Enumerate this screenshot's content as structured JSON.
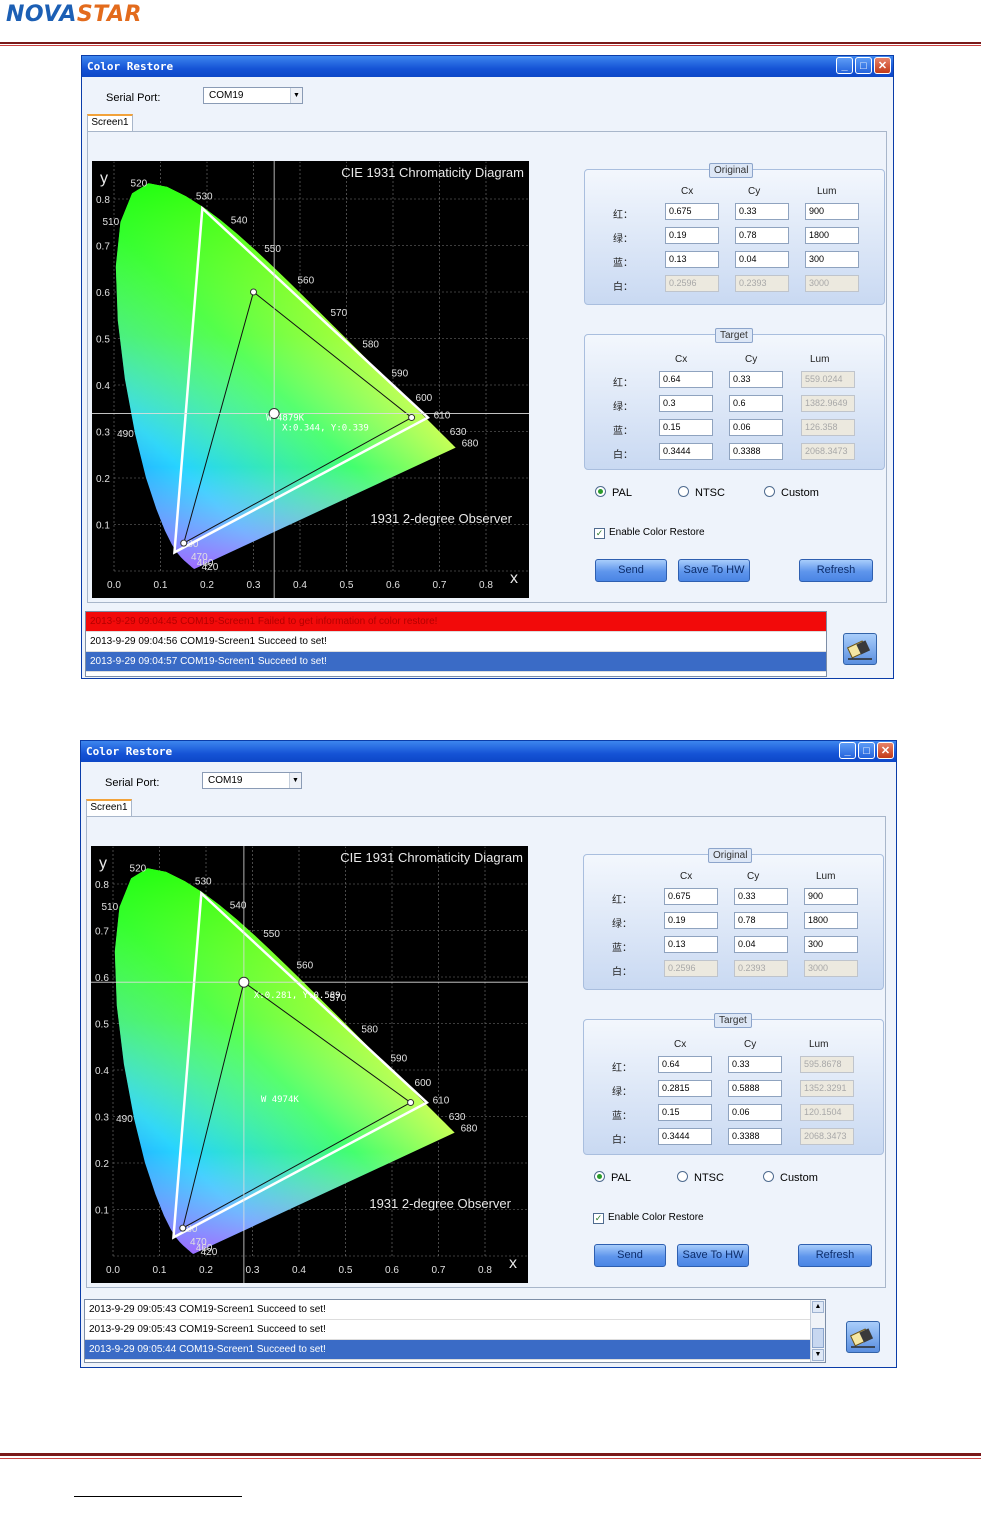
{
  "header": {
    "logo_a": "NOVA",
    "logo_b": "STAR"
  },
  "windows": [
    {
      "title": "Color Restore",
      "serial_port_label": "Serial Port:",
      "serial_port_value": "COM19",
      "tab": "Screen1",
      "chart": {
        "title": "CIE 1931 Chromaticity Diagram",
        "observer": "1931 2-degree Observer",
        "xlabel": "x",
        "ylabel": "y",
        "cursor_label": "W 4879K",
        "cursor_coords": "X:0.344, Y:0.339"
      },
      "original": {
        "title": "Original",
        "headers": [
          "Cx",
          "Cy",
          "Lum"
        ],
        "rows": [
          {
            "label": "红：",
            "cx": "0.675",
            "cy": "0.33",
            "lum": "900"
          },
          {
            "label": "绿：",
            "cx": "0.19",
            "cy": "0.78",
            "lum": "1800"
          },
          {
            "label": "蓝：",
            "cx": "0.13",
            "cy": "0.04",
            "lum": "300"
          },
          {
            "label": "白：",
            "cx": "0.2596",
            "cy": "0.2393",
            "lum": "3000"
          }
        ]
      },
      "target": {
        "title": "Target",
        "headers": [
          "Cx",
          "Cy",
          "Lum"
        ],
        "rows": [
          {
            "label": "红：",
            "cx": "0.64",
            "cy": "0.33",
            "lum": "559.0244"
          },
          {
            "label": "绿：",
            "cx": "0.3",
            "cy": "0.6",
            "lum": "1382.9649"
          },
          {
            "label": "蓝：",
            "cx": "0.15",
            "cy": "0.06",
            "lum": "126.358"
          },
          {
            "label": "白：",
            "cx": "0.3444",
            "cy": "0.3388",
            "lum": "2068.3473"
          }
        ]
      },
      "radios": [
        "PAL",
        "NTSC",
        "Custom"
      ],
      "selected_radio": "PAL",
      "enable_label": "Enable Color Restore",
      "enable_checked": true,
      "buttons": {
        "send": "Send",
        "save": "Save To HW",
        "refresh": "Refresh"
      },
      "log": [
        "2013-9-29 09:04:45 COM19-Screen1 Failed to get information of color restore!",
        "2013-9-29 09:04:56 COM19-Screen1 Succeed to set!",
        "2013-9-29 09:04:57 COM19-Screen1 Succeed to set!"
      ]
    },
    {
      "title": "Color Restore",
      "serial_port_label": "Serial Port:",
      "serial_port_value": "COM19",
      "tab": "Screen1",
      "chart": {
        "title": "CIE 1931 Chromaticity Diagram",
        "observer": "1931 2-degree Observer",
        "xlabel": "x",
        "ylabel": "y",
        "cursor_label": "W 4974K",
        "cursor_coords": "X:0.281, Y:0.589"
      },
      "original": {
        "title": "Original",
        "headers": [
          "Cx",
          "Cy",
          "Lum"
        ],
        "rows": [
          {
            "label": "红：",
            "cx": "0.675",
            "cy": "0.33",
            "lum": "900"
          },
          {
            "label": "绿：",
            "cx": "0.19",
            "cy": "0.78",
            "lum": "1800"
          },
          {
            "label": "蓝：",
            "cx": "0.13",
            "cy": "0.04",
            "lum": "300"
          },
          {
            "label": "白：",
            "cx": "0.2596",
            "cy": "0.2393",
            "lum": "3000"
          }
        ]
      },
      "target": {
        "title": "Target",
        "headers": [
          "Cx",
          "Cy",
          "Lum"
        ],
        "rows": [
          {
            "label": "红：",
            "cx": "0.64",
            "cy": "0.33",
            "lum": "595.8678"
          },
          {
            "label": "绿：",
            "cx": "0.2815",
            "cy": "0.5888",
            "lum": "1352.3291"
          },
          {
            "label": "蓝：",
            "cx": "0.15",
            "cy": "0.06",
            "lum": "120.1504"
          },
          {
            "label": "白：",
            "cx": "0.3444",
            "cy": "0.3388",
            "lum": "2068.3473"
          }
        ]
      },
      "radios": [
        "PAL",
        "NTSC",
        "Custom"
      ],
      "selected_radio": "PAL",
      "enable_label": "Enable Color Restore",
      "enable_checked": true,
      "buttons": {
        "send": "Send",
        "save": "Save To HW",
        "refresh": "Refresh"
      },
      "log": [
        "2013-9-29 09:05:43 COM19-Screen1 Succeed to set!",
        "2013-9-29 09:05:43 COM19-Screen1 Succeed to set!",
        "2013-9-29 09:05:44 COM19-Screen1 Succeed to set!"
      ]
    }
  ]
}
